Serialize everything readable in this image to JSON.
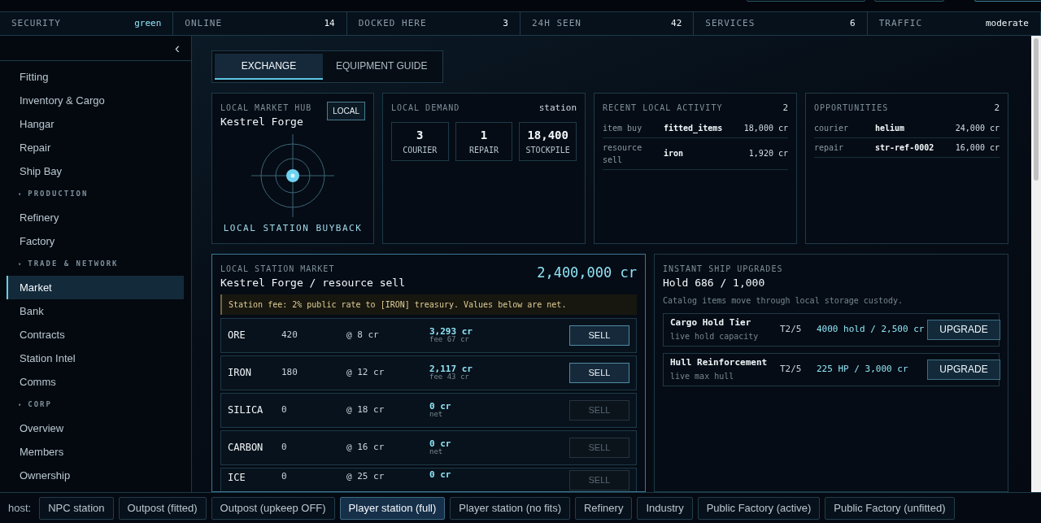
{
  "stats": [
    {
      "label": "SECURITY",
      "value": "green",
      "accent": true
    },
    {
      "label": "ONLINE",
      "value": "14",
      "accent": false
    },
    {
      "label": "DOCKED HERE",
      "value": "3",
      "accent": false
    },
    {
      "label": "24H SEEN",
      "value": "42",
      "accent": false
    },
    {
      "label": "SERVICES",
      "value": "6",
      "accent": false
    },
    {
      "label": "TRAFFIC",
      "value": "moderate",
      "accent": false
    }
  ],
  "sidebar": {
    "collapse": "‹",
    "items": [
      {
        "kind": "item",
        "label": "Fitting",
        "selected": false
      },
      {
        "kind": "item",
        "label": "Inventory & Cargo",
        "selected": false
      },
      {
        "kind": "item",
        "label": "Hangar",
        "selected": false
      },
      {
        "kind": "item",
        "label": "Repair",
        "selected": false
      },
      {
        "kind": "item",
        "label": "Ship Bay",
        "selected": false
      },
      {
        "kind": "section",
        "marker": "▾",
        "label": "PRODUCTION"
      },
      {
        "kind": "item",
        "label": "Refinery",
        "selected": false
      },
      {
        "kind": "item",
        "label": "Factory",
        "selected": false
      },
      {
        "kind": "section",
        "marker": "▾",
        "label": "TRADE & NETWORK"
      },
      {
        "kind": "item",
        "label": "Market",
        "selected": true
      },
      {
        "kind": "item",
        "label": "Bank",
        "selected": false
      },
      {
        "kind": "item",
        "label": "Contracts",
        "selected": false
      },
      {
        "kind": "item",
        "label": "Station Intel",
        "selected": false
      },
      {
        "kind": "item",
        "label": "Comms",
        "selected": false
      },
      {
        "kind": "section",
        "marker": "▾",
        "label": "CORP"
      },
      {
        "kind": "item",
        "label": "Overview",
        "selected": false
      },
      {
        "kind": "item",
        "label": "Members",
        "selected": false
      },
      {
        "kind": "item",
        "label": "Ownership",
        "selected": false
      }
    ]
  },
  "tabs": [
    {
      "label": "EXCHANGE",
      "selected": true
    },
    {
      "label": "EQUIPMENT GUIDE",
      "selected": false
    }
  ],
  "hub": {
    "title": "LOCAL MARKET HUB",
    "name": "Kestrel Forge",
    "badge": "LOCAL",
    "caption": "LOCAL STATION BUYBACK"
  },
  "demand": {
    "title": "LOCAL DEMAND",
    "scope": "station",
    "stats": [
      {
        "value": "3",
        "label": "COURIER"
      },
      {
        "value": "1",
        "label": "REPAIR"
      },
      {
        "value": "18,400",
        "label": "STOCKPILE"
      }
    ]
  },
  "activity": {
    "title": "RECENT LOCAL ACTIVITY",
    "count": "2",
    "rows": [
      {
        "type": "item buy",
        "item": "fitted_items",
        "amount": "18,000 cr"
      },
      {
        "type": "resource sell",
        "item": "iron",
        "amount": "1,920 cr"
      }
    ]
  },
  "opportunities": {
    "title": "OPPORTUNITIES",
    "count": "2",
    "rows": [
      {
        "type": "courier",
        "item": "helium",
        "amount": "24,000 cr"
      },
      {
        "type": "repair",
        "item": "str-ref-0002",
        "amount": "16,000 cr"
      }
    ]
  },
  "market": {
    "title": "LOCAL STATION MARKET",
    "subtitle": "Kestrel Forge / resource sell",
    "balance": "2,400,000 cr",
    "notice": "Station fee: 2% public rate to [IRON] treasury. Values below are net.",
    "rows": [
      {
        "resource": "ORE",
        "qty": "420",
        "price": "@ 8 cr",
        "total": "3,293 cr",
        "sub": "fee 67 cr",
        "action": "SELL",
        "disabled": false
      },
      {
        "resource": "IRON",
        "qty": "180",
        "price": "@ 12 cr",
        "total": "2,117 cr",
        "sub": "fee 43 cr",
        "action": "SELL",
        "disabled": false
      },
      {
        "resource": "SILICA",
        "qty": "0",
        "price": "@ 18 cr",
        "total": "0 cr",
        "sub": "net",
        "action": "SELL",
        "disabled": true
      },
      {
        "resource": "CARBON",
        "qty": "0",
        "price": "@ 16 cr",
        "total": "0 cr",
        "sub": "net",
        "action": "SELL",
        "disabled": true
      },
      {
        "resource": "ICE",
        "qty": "0",
        "price": "@ 25 cr",
        "total": "0 cr",
        "action": "SELL",
        "disabled": true
      }
    ]
  },
  "upgrades": {
    "title": "INSTANT SHIP UPGRADES",
    "hold": "Hold 686 / 1,000",
    "note": "Catalog items move through local storage custody.",
    "rows": [
      {
        "name": "Cargo Hold Tier",
        "desc": "live hold capacity",
        "tier": "T2/5",
        "value": "4000 hold / 2,500 cr",
        "action": "UPGRADE"
      },
      {
        "name": "Hull Reinforcement",
        "desc": "live max hull",
        "tier": "T2/5",
        "value": "225 HP / 3,000 cr",
        "action": "UPGRADE"
      }
    ]
  },
  "host": {
    "label": "host:",
    "options": [
      {
        "label": "NPC station",
        "selected": false
      },
      {
        "label": "Outpost (fitted)",
        "selected": false
      },
      {
        "label": "Outpost (upkeep OFF)",
        "selected": false
      },
      {
        "label": "Player station (full)",
        "selected": true
      },
      {
        "label": "Player station (no fits)",
        "selected": false
      },
      {
        "label": "Refinery",
        "selected": false
      },
      {
        "label": "Industry",
        "selected": false
      },
      {
        "label": "Public Factory (active)",
        "selected": false
      },
      {
        "label": "Public Factory (unfitted)",
        "selected": false
      }
    ]
  }
}
